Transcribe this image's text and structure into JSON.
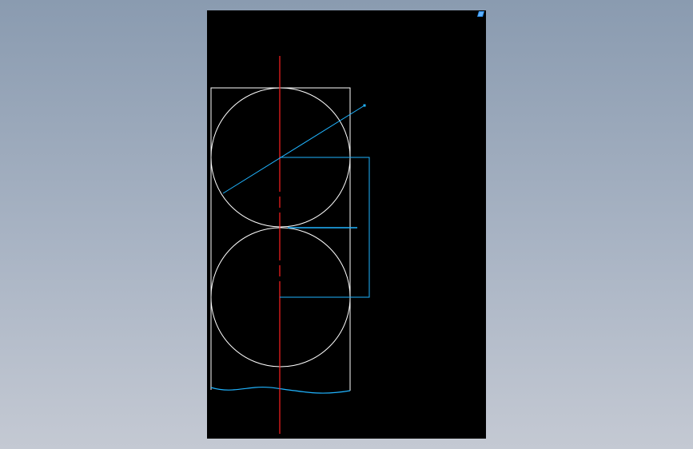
{
  "viewport": {
    "background": "#000000"
  },
  "colors": {
    "outline": "#ffffff",
    "centerline": "#ff2020",
    "leader": "#20b4ff",
    "corner_marker": "#2f8fe8"
  },
  "icons": {
    "corner_marker": "viewport-corner-marker-icon"
  }
}
